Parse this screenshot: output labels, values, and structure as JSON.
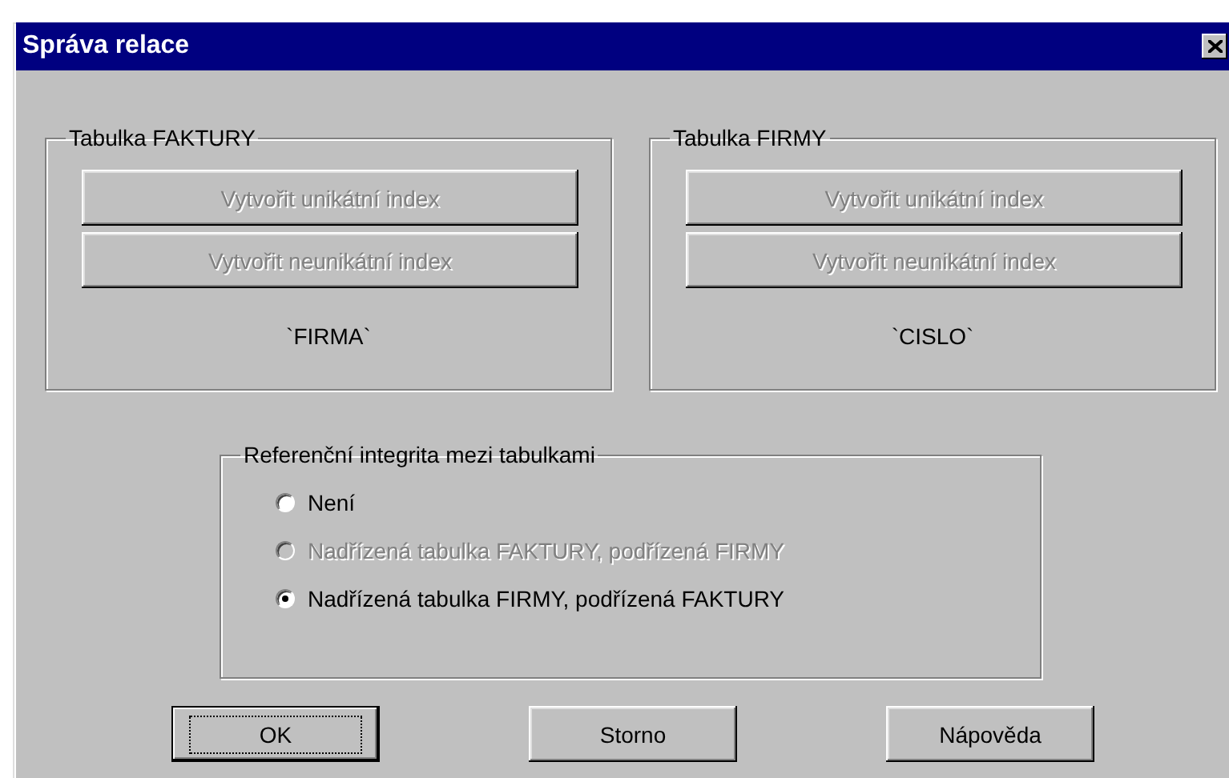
{
  "window": {
    "title": "Správa relace"
  },
  "tables": [
    {
      "title": "Tabulka FAKTURY",
      "buttons": [
        {
          "label": "Vytvořit unikátní index",
          "disabled": true
        },
        {
          "label": "Vytvořit neunikátní index",
          "disabled": true
        }
      ],
      "field": "`FIRMA`"
    },
    {
      "title": "Tabulka FIRMY",
      "buttons": [
        {
          "label": "Vytvořit unikátní index",
          "disabled": true
        },
        {
          "label": "Vytvořit neunikátní index",
          "disabled": true
        }
      ],
      "field": "`CISLO`"
    }
  ],
  "integrity": {
    "title": "Referenční integrita mezi tabulkami",
    "options": [
      {
        "label": "Není",
        "selected": false,
        "disabled": false
      },
      {
        "label": "Nadřízená tabulka FAKTURY, podřízená FIRMY",
        "selected": false,
        "disabled": true
      },
      {
        "label": "Nadřízená tabulka FIRMY, podřízená FAKTURY",
        "selected": true,
        "disabled": false
      }
    ]
  },
  "buttons": [
    {
      "label": "OK",
      "default": true
    },
    {
      "label": "Storno",
      "default": false
    },
    {
      "label": "Nápověda",
      "default": false
    }
  ]
}
